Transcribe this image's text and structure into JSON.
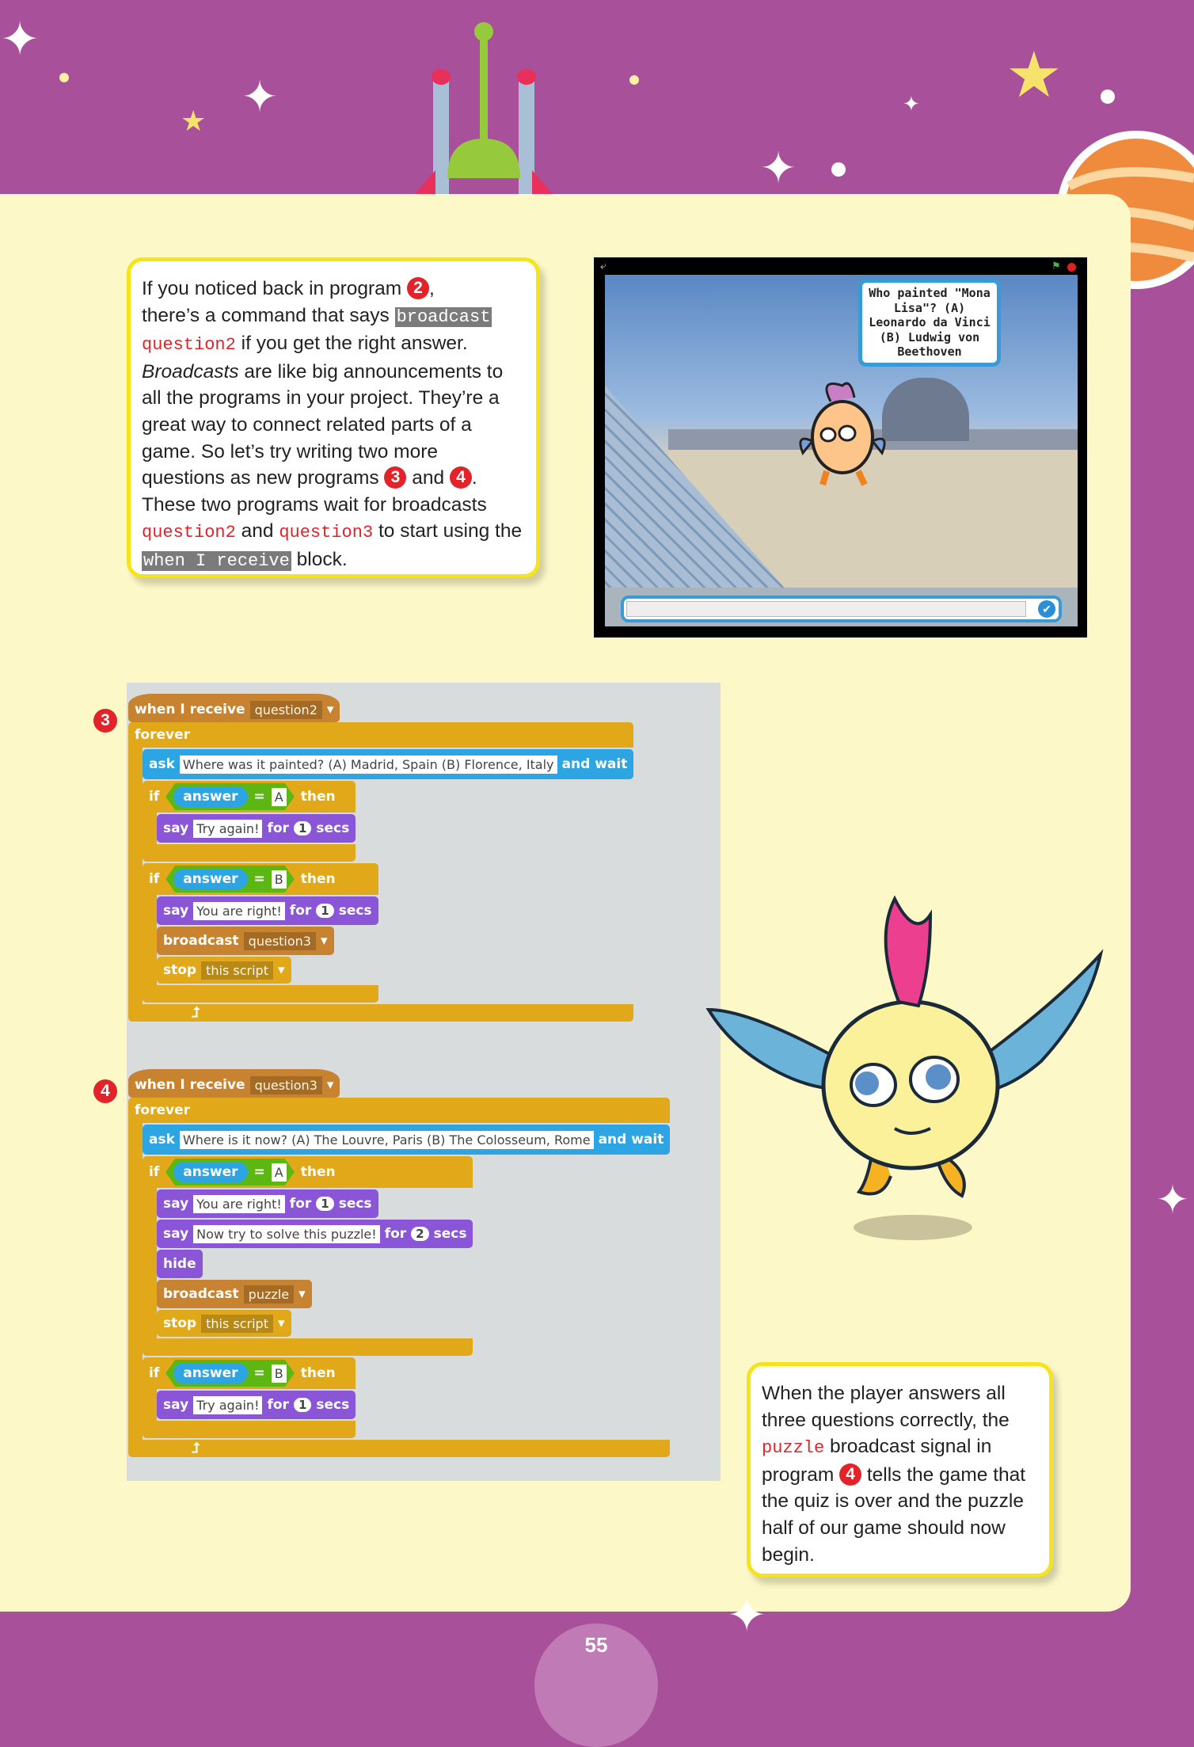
{
  "intro": {
    "l1": "If you noticed back in program ",
    "b2": "2",
    "l1b": ",",
    "l2": "there’s a command that says ",
    "code_broadcast": "broadcast",
    "code_q2": "question2",
    "l3": " if you get the right answer.",
    "italic": "Broadcasts",
    "l4": " are like big announcements to all the programs in your project. They’re a great way to connect related parts of a game. So let’s try writing two more questions as new programs ",
    "b3": "3",
    "l5": "and ",
    "b4": "4",
    "l6": ". These two programs wait for broadcasts ",
    "code_q2b": "question2",
    "l7": " and ",
    "code_q3": "question3",
    "l8": " to start using the ",
    "code_receive": "when I receive",
    "l9": " block."
  },
  "stage": {
    "bubble": "Who painted \"Mona Lisa\"? (A) Leonardo da Vinci (B) Ludwig von Beethoven",
    "answer_input": ""
  },
  "scripts": [
    {
      "badge": "3",
      "hat": {
        "label": "when I receive",
        "value": "question2"
      },
      "forever": "forever",
      "body": [
        {
          "type": "ask",
          "label": "ask",
          "text": "Where was it painted? (A) Madrid, Spain (B) Florence, Italy",
          "suffix": "and wait"
        },
        {
          "type": "if",
          "label": "if",
          "reporter": "answer",
          "op": "=",
          "value": "A",
          "then": "then",
          "body": [
            {
              "type": "say",
              "label": "say",
              "text": "Try again!",
              "for": "for",
              "secs": "1",
              "unit": "secs"
            }
          ]
        },
        {
          "type": "if",
          "label": "if",
          "reporter": "answer",
          "op": "=",
          "value": "B",
          "then": "then",
          "body": [
            {
              "type": "say",
              "label": "say",
              "text": "You are right!",
              "for": "for",
              "secs": "1",
              "unit": "secs"
            },
            {
              "type": "broadcast",
              "label": "broadcast",
              "value": "question3"
            },
            {
              "type": "stop",
              "label": "stop",
              "value": "this script"
            }
          ]
        }
      ]
    },
    {
      "badge": "4",
      "hat": {
        "label": "when I receive",
        "value": "question3"
      },
      "forever": "forever",
      "body": [
        {
          "type": "ask",
          "label": "ask",
          "text": "Where is it now? (A) The Louvre, Paris (B) The Colosseum, Rome",
          "suffix": "and wait"
        },
        {
          "type": "if",
          "label": "if",
          "reporter": "answer",
          "op": "=",
          "value": "A",
          "then": "then",
          "body": [
            {
              "type": "say",
              "label": "say",
              "text": "You are right!",
              "for": "for",
              "secs": "1",
              "unit": "secs"
            },
            {
              "type": "say",
              "label": "say",
              "text": "Now try to solve this puzzle!",
              "for": "for",
              "secs": "2",
              "unit": "secs"
            },
            {
              "type": "hide",
              "label": "hide"
            },
            {
              "type": "broadcast",
              "label": "broadcast",
              "value": "puzzle"
            },
            {
              "type": "stop",
              "label": "stop",
              "value": "this script"
            }
          ]
        },
        {
          "type": "if",
          "label": "if",
          "reporter": "answer",
          "op": "=",
          "value": "B",
          "then": "then",
          "body": [
            {
              "type": "say",
              "label": "say",
              "text": "Try again!",
              "for": "for",
              "secs": "1",
              "unit": "secs"
            }
          ]
        }
      ]
    }
  ],
  "note": {
    "l1": "When the player answers all three questions correctly, the ",
    "code_puzzle": "puzzle",
    "l2": " broadcast signal in program ",
    "b4": "4",
    "l3": " tells the game that the quiz is over and the puzzle half of our game should now begin."
  },
  "page_number": "55",
  "colors": {
    "background": "#a8509a",
    "panel": "#fdf8c8",
    "box_border": "#f6e41b",
    "badge": "#e2232a",
    "code_red": "#e2232a",
    "control": "#e1a91a",
    "events": "#c88330",
    "sensing": "#2ca5e2",
    "looks": "#8a55d7",
    "operators": "#5cb712"
  }
}
